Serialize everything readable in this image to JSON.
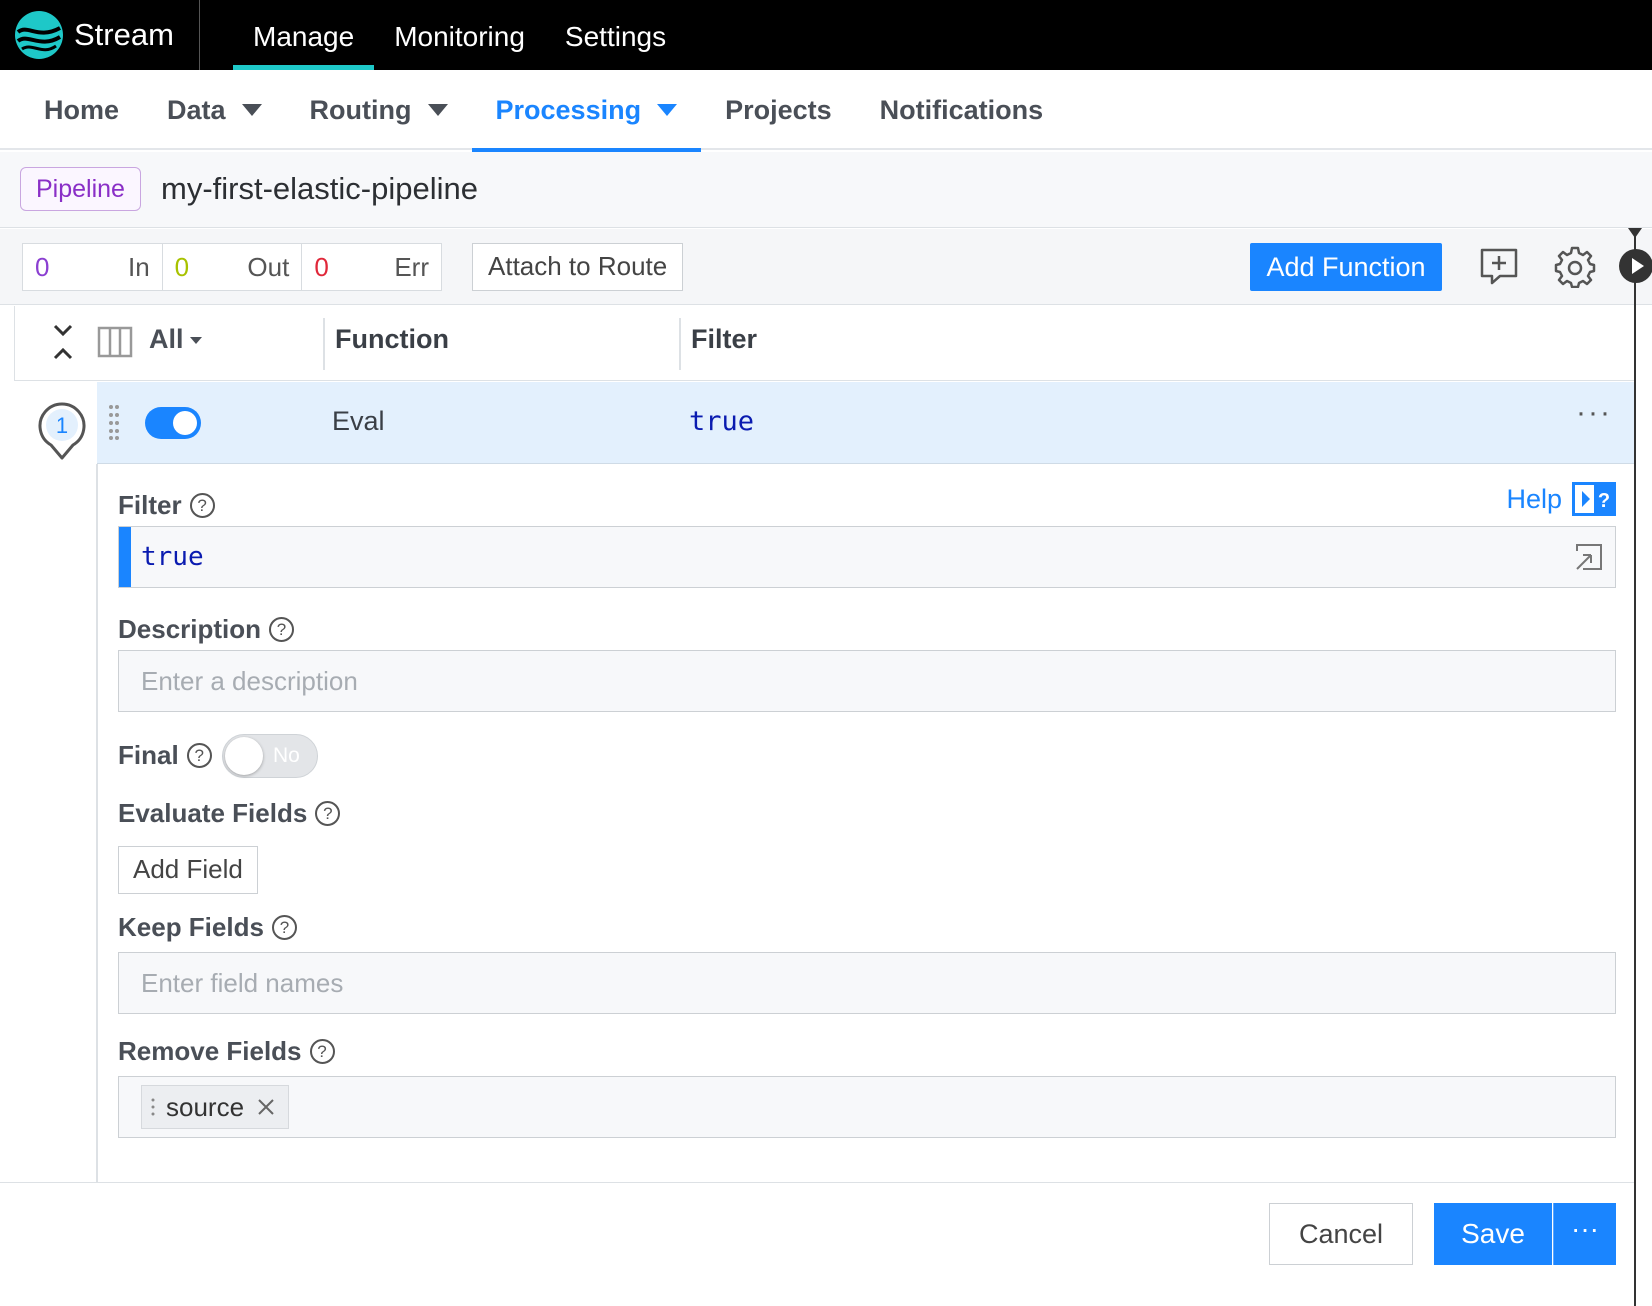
{
  "app": {
    "name": "Stream"
  },
  "top_nav": [
    {
      "label": "Manage",
      "active": true
    },
    {
      "label": "Monitoring",
      "active": false
    },
    {
      "label": "Settings",
      "active": false
    }
  ],
  "sub_nav": [
    {
      "label": "Home"
    },
    {
      "label": "Data"
    },
    {
      "label": "Routing"
    },
    {
      "label": "Processing"
    },
    {
      "label": "Projects"
    },
    {
      "label": "Notifications"
    }
  ],
  "pipeline": {
    "badge": "Pipeline",
    "name": "my-first-elastic-pipeline"
  },
  "stats": {
    "in_count": "0",
    "in_label": "In",
    "out_count": "0",
    "out_label": "Out",
    "err_count": "0",
    "err_label": "Err"
  },
  "toolbar": {
    "attach_label": "Attach to Route",
    "add_function_label": "Add Function"
  },
  "columns": {
    "all_label": "All",
    "function_label": "Function",
    "filter_label": "Filter"
  },
  "function_row": {
    "step": "1",
    "name": "Eval",
    "filter": "true",
    "enabled": true,
    "more": "···"
  },
  "form": {
    "help_label": "Help",
    "filter_label": "Filter",
    "filter_value": "true",
    "description_label": "Description",
    "description_placeholder": "Enter a description",
    "final_label": "Final",
    "final_toggle_text": "No",
    "evaluate_label": "Evaluate Fields",
    "add_field_label": "Add Field",
    "keep_label": "Keep Fields",
    "keep_placeholder": "Enter field names",
    "remove_label": "Remove Fields",
    "remove_tags": [
      "source"
    ]
  },
  "footer": {
    "cancel_label": "Cancel",
    "save_label": "Save",
    "more_label": "···"
  },
  "colors": {
    "accent": "#1a85ff",
    "nav_underline": "#1ec8c8",
    "in": "#8b3fd1",
    "out": "#a8c200",
    "err": "#e0283a"
  }
}
